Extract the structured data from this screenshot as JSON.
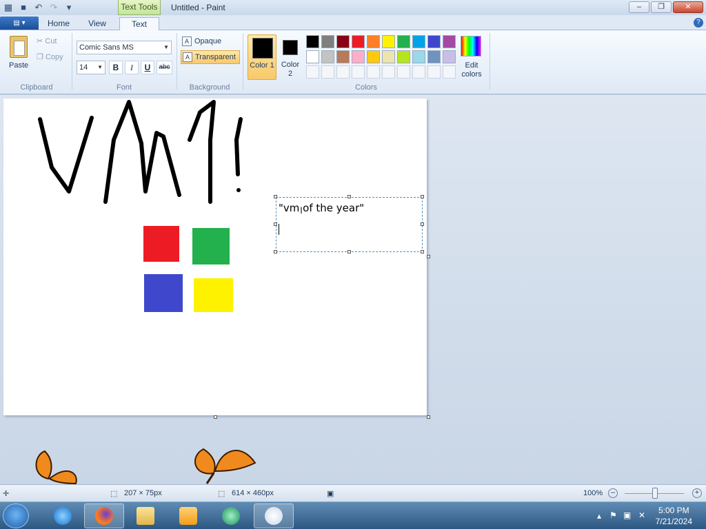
{
  "window": {
    "title": "Untitled - Paint",
    "contextual_tab": "Text Tools"
  },
  "tabs": [
    {
      "label": "Home"
    },
    {
      "label": "View"
    },
    {
      "label": "Text"
    }
  ],
  "ribbon": {
    "clipboard": {
      "group_label": "Clipboard",
      "paste": "Paste",
      "cut": "Cut",
      "copy": "Copy"
    },
    "font": {
      "group_label": "Font",
      "family": "Comic Sans MS",
      "size": "14",
      "bold": "B",
      "italic": "I",
      "underline": "U",
      "strikethrough": "abc"
    },
    "background": {
      "group_label": "Background",
      "opaque": "Opaque",
      "transparent": "Transparent",
      "selected": "Transparent"
    },
    "colors": {
      "group_label": "Colors",
      "color1_label": "Color 1",
      "color1_value": "#000000",
      "color2_label": "Color 2",
      "color2_value": "#000000",
      "edit_colors": "Edit colors",
      "palette_row1": [
        "#000000",
        "#7f7f7f",
        "#880015",
        "#ed1c24",
        "#ff7f27",
        "#fff200",
        "#22b14c",
        "#00a2e8",
        "#3f48cc",
        "#a349a4"
      ],
      "palette_row2": [
        "#ffffff",
        "#c3c3c3",
        "#b97a57",
        "#ffaec9",
        "#ffc90e",
        "#efe4b0",
        "#b5e61d",
        "#99d9ea",
        "#7092be",
        "#c8bfe7"
      ]
    }
  },
  "canvas": {
    "text_box_content": "\"vm of the year\"",
    "squares": [
      {
        "color": "#ed1c24"
      },
      {
        "color": "#22b14c"
      },
      {
        "color": "#3f48cc"
      },
      {
        "color": "#fff200"
      }
    ]
  },
  "status": {
    "selection_size": "207 × 75px",
    "canvas_size": "614 × 460px",
    "zoom": "100%"
  },
  "taskbar": {
    "time": "5:00 PM",
    "date": "7/21/2024"
  }
}
